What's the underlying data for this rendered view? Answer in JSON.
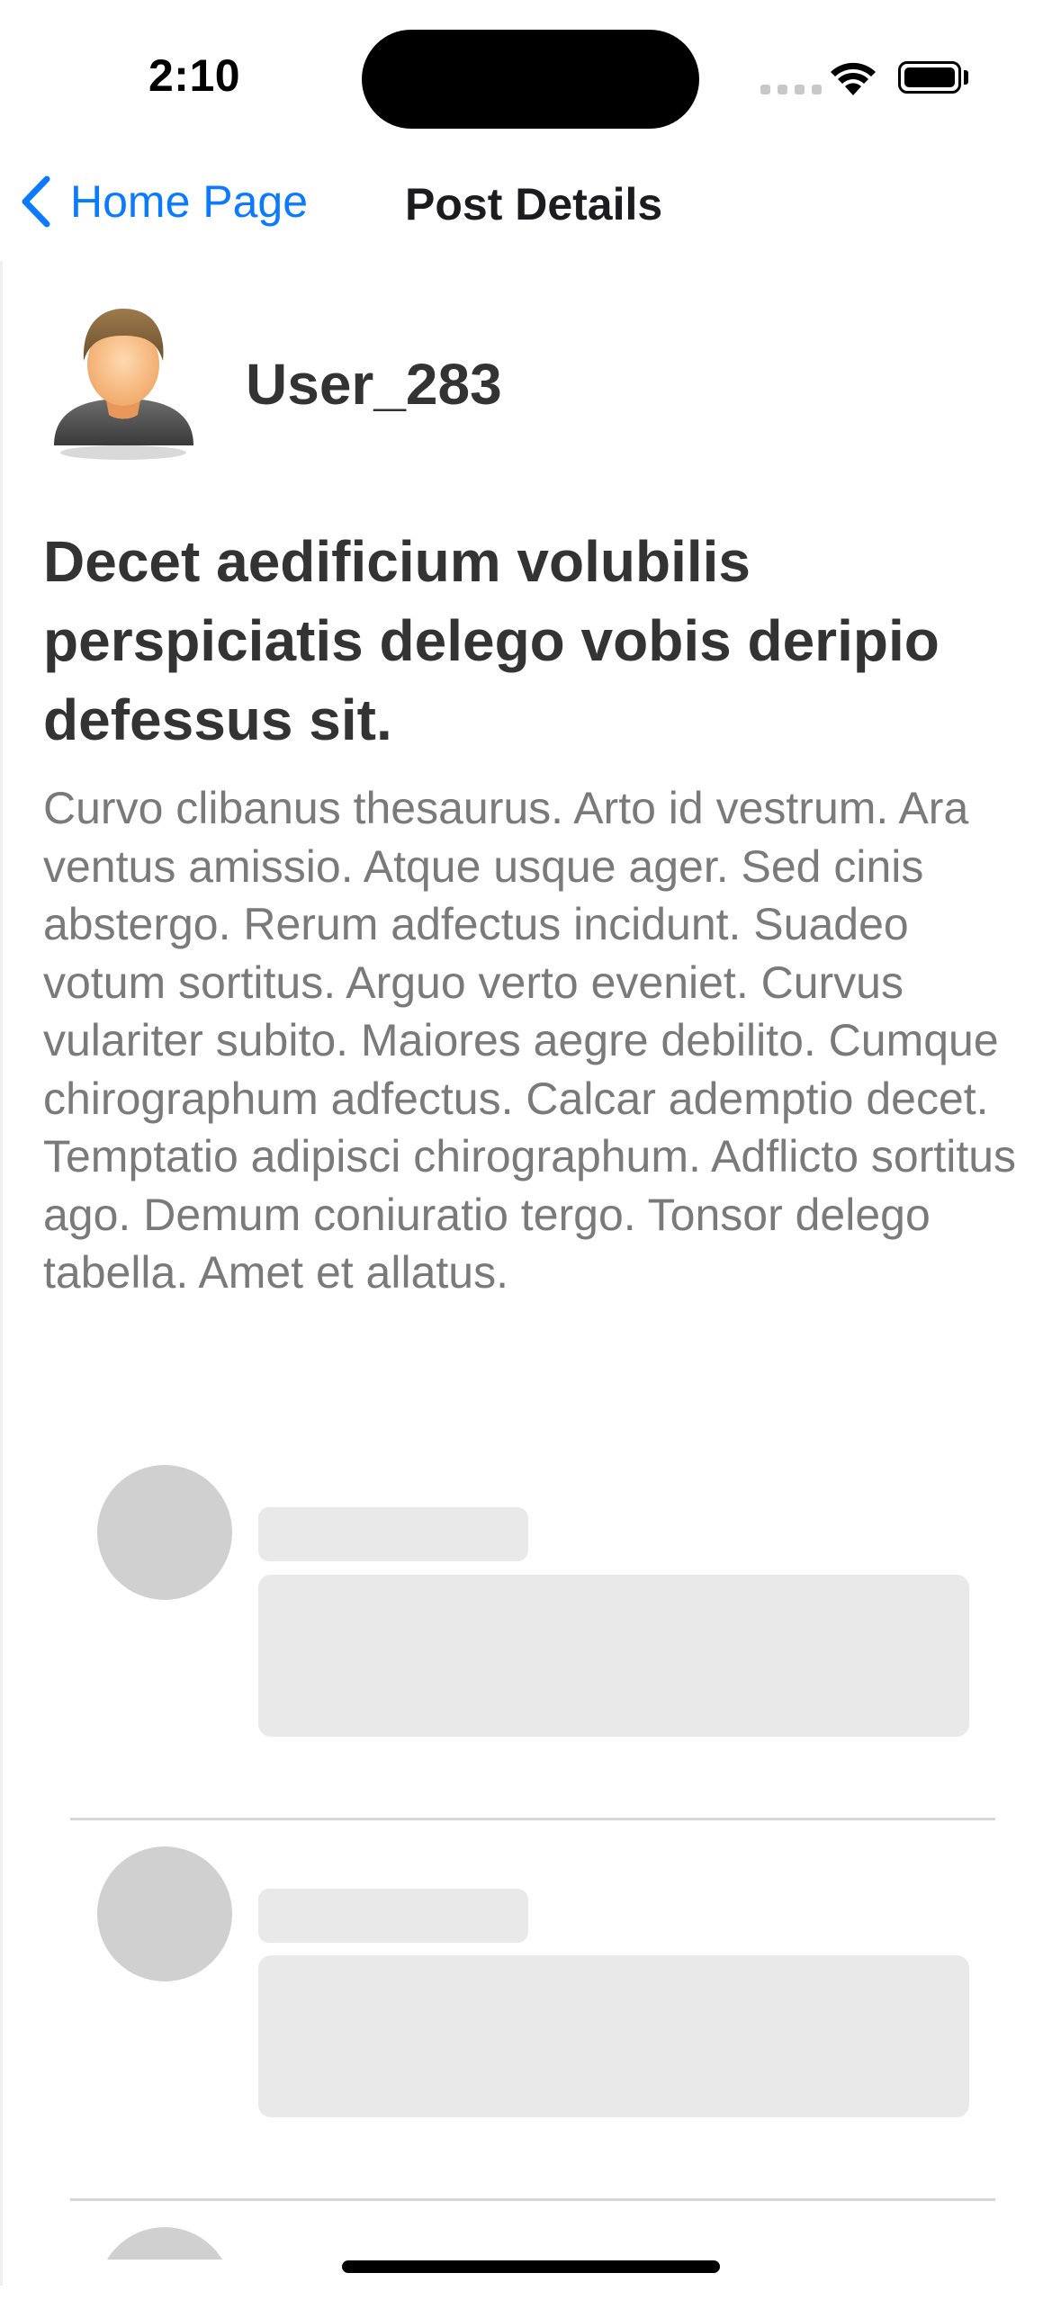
{
  "status_bar": {
    "time": "2:10",
    "icons": [
      "cellular-signal-icon",
      "wifi-icon",
      "battery-icon"
    ]
  },
  "nav": {
    "back_label": "Home Page",
    "title": "Post Details",
    "accent_color": "#0a7aff"
  },
  "post": {
    "author": "User_283",
    "title": "Decet aedificium volubilis perspiciatis delego vobis deripio defessus sit.",
    "body": "Curvo clibanus thesaurus. Arto id vestrum. Ara ventus amissio. Atque usque ager. Sed cinis abstergo. Rerum adfectus incidunt. Suadeo votum sortitus. Arguo verto eveniet. Curvus vulariter subito. Maiores aegre debilito. Cumque chirographum adfectus. Calcar ademptio decet. Temptatio adipisci chirographum. Adflicto sortitus ago. Demum coniuratio tergo. Tonsor delego tabella. Amet et allatus."
  },
  "comments": {
    "state": "loading",
    "placeholder_count_visible": 3
  }
}
